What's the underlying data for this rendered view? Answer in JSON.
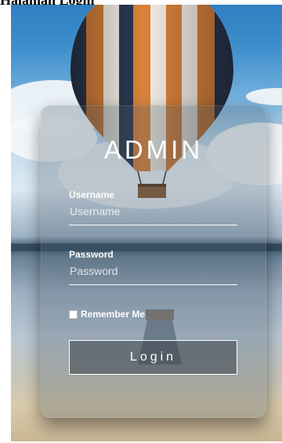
{
  "page": {
    "heading": "Halaman Login"
  },
  "login": {
    "title": "ADMIN",
    "username_label": "Username",
    "username_placeholder": "Username",
    "password_label": "Password",
    "password_placeholder": "Password",
    "remember_label": "Remember Me",
    "remember_checked": false,
    "submit_label": "Login"
  },
  "background": {
    "icon": "hot-air-balloon-icon",
    "colors": {
      "balloon_orange": "#d9823b",
      "balloon_white": "#f2ede4",
      "balloon_navy": "#2d3850",
      "sky": "#3f8fcd"
    }
  }
}
